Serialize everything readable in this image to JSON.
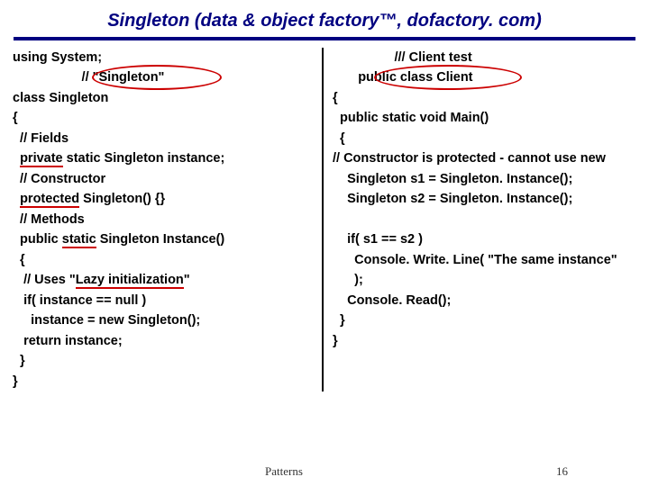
{
  "title": "Singleton (data & object factory™, dofactory. com)",
  "left": {
    "l1": "using System;",
    "l2": "                   // \"Singleton\"",
    "l3": "class Singleton",
    "l4": "{",
    "l5": "  // Fields",
    "l6a": "  ",
    "l6b": "private",
    "l6c": " static Singleton instance;",
    "l7": "  // Constructor",
    "l8a": "  ",
    "l8b": "protected",
    "l8c": " Singleton() {}",
    "l9": "  // Methods",
    "l10a": "  public ",
    "l10b": "static",
    "l10c": " Singleton Instance()",
    "l11": "  {",
    "l12a": "   // Uses \"",
    "l12b": "Lazy initialization",
    "l12c": "\"",
    "l13": "   if( instance == null )",
    "l14": "     instance = new Singleton();",
    "l15": "   return instance;",
    "l16": "  }",
    "l17": "}"
  },
  "right": {
    "r1": "                 /// Client test",
    "r2": "       public class Client",
    "r3": "{",
    "r4": "  public static void Main()",
    "r5": "  {",
    "r6": "// Constructor is protected - cannot use new",
    "r7": "    Singleton s1 = Singleton. Instance();",
    "r8": "    Singleton s2 = Singleton. Instance();",
    "r9": " ",
    "r10": "    if( s1 == s2 )",
    "r11": "      Console. Write. Line( \"The same instance\"",
    "r12": "      );",
    "r13": "    Console. Read();",
    "r14": "  }",
    "r15": "}"
  },
  "footer": {
    "center": "Patterns",
    "page": "16"
  }
}
